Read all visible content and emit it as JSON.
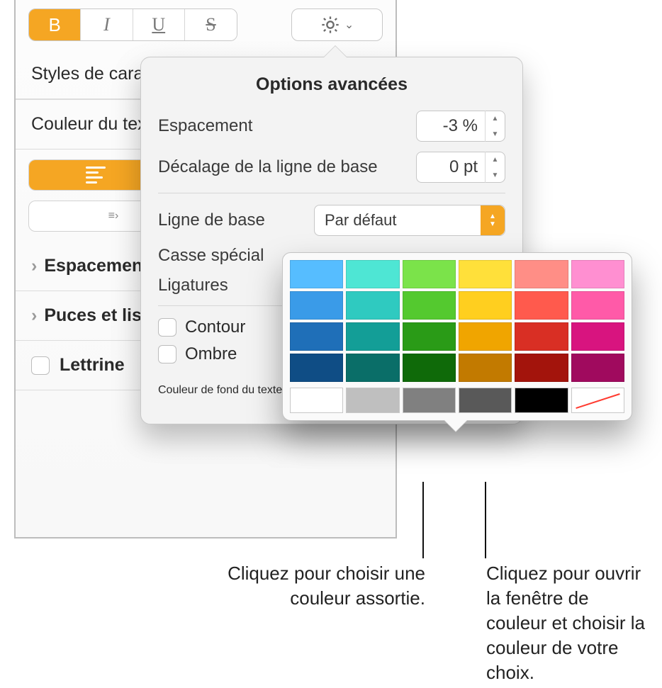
{
  "sidebar": {
    "styles_label": "Styles de cara",
    "textcolor_label": "Couleur du tex",
    "spacing_label": "Espacemen",
    "bullets_label": "Puces et lis",
    "dropcap_label": "Lettrine"
  },
  "toolbar": {
    "bold": "B",
    "italic": "I",
    "underline": "U",
    "strike": "S"
  },
  "popover": {
    "title": "Options avancées",
    "rows": {
      "espacement_label": "Espacement",
      "espacement_value": "-3 %",
      "baseline_shift_label": "Décalage de la ligne de base",
      "baseline_shift_value": "0 pt",
      "baseline_label": "Ligne de base",
      "baseline_value": "Par défaut",
      "casse_label": "Casse spécial",
      "ligatures_label": "Ligatures",
      "contour_label": "Contour",
      "ombre_label": "Ombre",
      "bgcolor_label": "Couleur de fond du texte"
    }
  },
  "chart_data": {
    "type": "palette",
    "columns": 6,
    "rows": [
      [
        "#56bdff",
        "#4ee6d4",
        "#7be34a",
        "#ffe03a",
        "#ff8e86",
        "#ff8fd1"
      ],
      [
        "#3a9be8",
        "#2fcac0",
        "#54c92f",
        "#ffcf1f",
        "#ff5a4d",
        "#ff5aa8"
      ],
      [
        "#1f6fb8",
        "#139e97",
        "#2a9b17",
        "#f0a500",
        "#d92f24",
        "#d8147f"
      ],
      [
        "#0f4d85",
        "#0a6e68",
        "#0f6a09",
        "#c27a00",
        "#a3140c",
        "#a00a5e"
      ]
    ],
    "neutral_row": [
      "#ffffff",
      "#bfbfbf",
      "#808080",
      "#595959",
      "#000000",
      "none"
    ]
  },
  "callouts": {
    "left": "Cliquez pour choisir une couleur assortie.",
    "right": "Cliquez pour ouvrir la fenêtre de couleur et choisir la couleur de votre choix."
  }
}
